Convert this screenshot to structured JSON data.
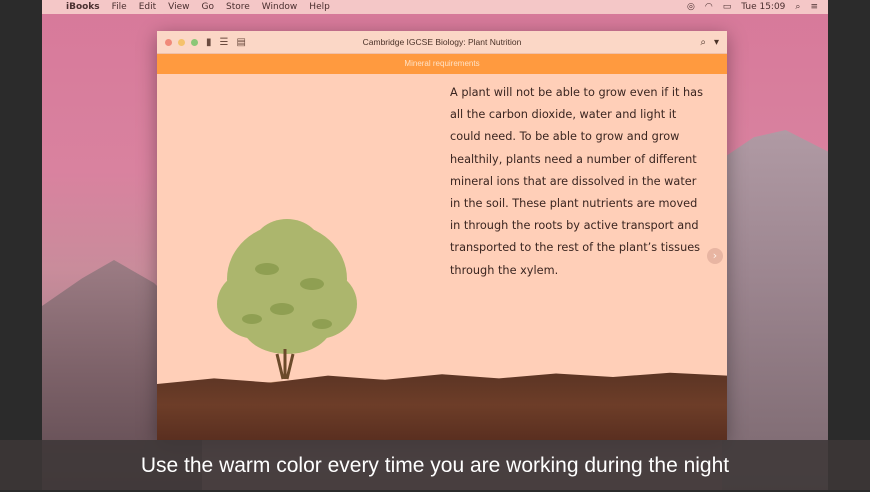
{
  "menubar": {
    "apple_icon": "apple-logo-icon",
    "app_name": "iBooks",
    "items": [
      "File",
      "Edit",
      "View",
      "Go",
      "Store",
      "Window",
      "Help"
    ],
    "clock": "Tue 15:09"
  },
  "window": {
    "title": "Cambridge IGCSE Biology: Plant Nutrition",
    "chapter": "Mineral requirements",
    "body": "A plant will not be able to grow even if it has all the carbon dioxide, water and light it could need. To be able to grow and grow healthily, plants need a number of different mineral ions that are dissolved in the water in the soil. These plant nutrients are moved in through the roots by active transport and transported to the rest of the plant’s tissues through the xylem."
  },
  "caption": "Use the warm color every time you are working during the night",
  "colors": {
    "chapter_bar": "#ff9a3f",
    "page_bg": "#ffcfb8",
    "menubar": "#f4c7c7"
  }
}
